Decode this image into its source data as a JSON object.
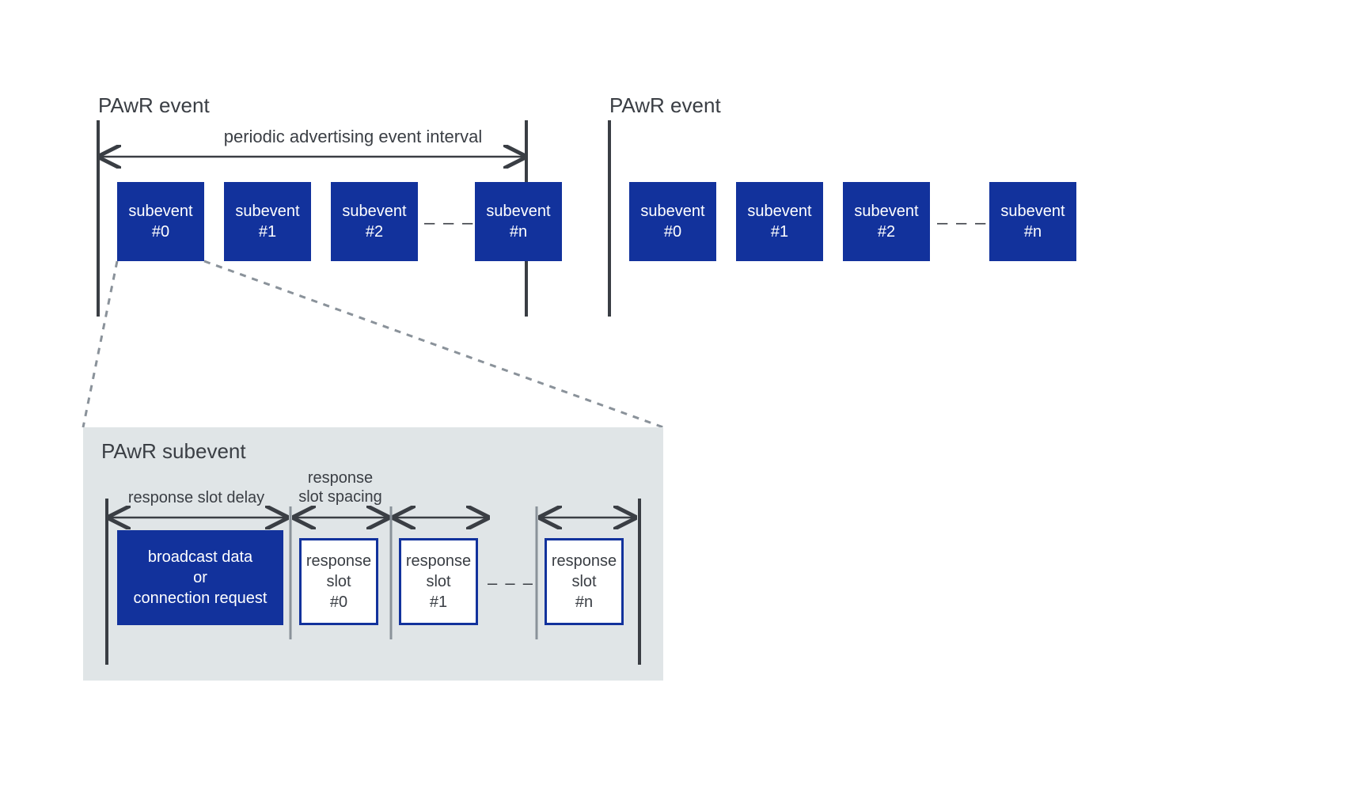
{
  "top": {
    "event1_title": "PAwR event",
    "event2_title": "PAwR event",
    "interval_label": "periodic advertising event interval",
    "subevents": [
      {
        "line1": "subevent",
        "line2": "#0"
      },
      {
        "line1": "subevent",
        "line2": "#1"
      },
      {
        "line1": "subevent",
        "line2": "#2"
      },
      {
        "line1": "subevent",
        "line2": "#n"
      }
    ],
    "ellipsis": "– – –"
  },
  "sub": {
    "title": "PAwR subevent",
    "delay_label": "response slot delay",
    "spacing_label_l1": "response",
    "spacing_label_l2": "slot spacing",
    "broadcast_l1": "broadcast data",
    "broadcast_l2": "or",
    "broadcast_l3": "connection request",
    "slots": [
      {
        "l1": "response",
        "l2": "slot",
        "l3": "#0"
      },
      {
        "l1": "response",
        "l2": "slot",
        "l3": "#1"
      },
      {
        "l1": "response",
        "l2": "slot",
        "l3": "#n"
      }
    ],
    "ellipsis": "– – –"
  },
  "colors": {
    "box": "#12329c",
    "panel": "#e0e5e7",
    "line": "#3a3e44",
    "dash": "#8a929a"
  }
}
